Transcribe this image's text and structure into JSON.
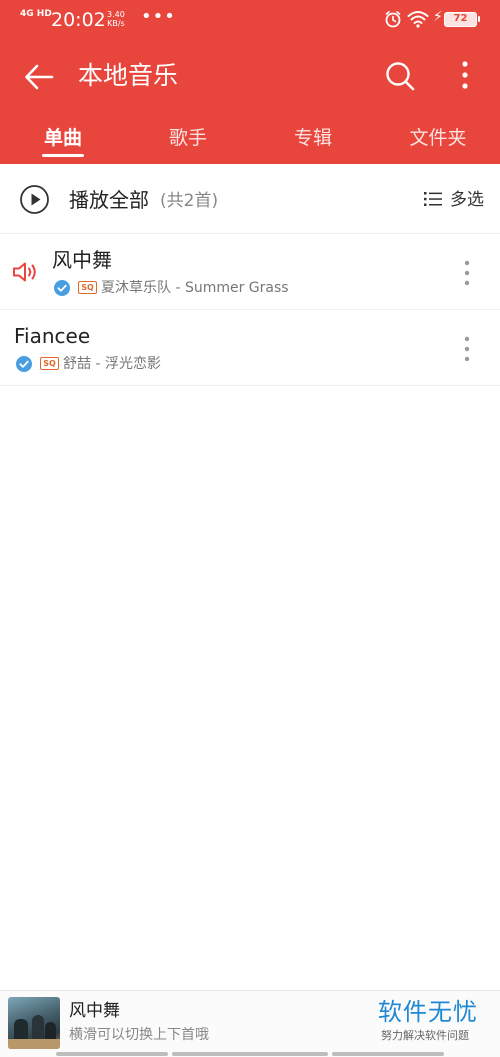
{
  "status_bar": {
    "network": "4G HD",
    "time": "20:02",
    "speed_value": "3.40",
    "speed_unit": "KB/s",
    "more": "•••",
    "battery": "72"
  },
  "header": {
    "title": "本地音乐",
    "tabs": [
      {
        "label": "单曲",
        "active": true
      },
      {
        "label": "歌手",
        "active": false
      },
      {
        "label": "专辑",
        "active": false
      },
      {
        "label": "文件夹",
        "active": false
      }
    ]
  },
  "play_all": {
    "label": "播放全部",
    "count": "(共2首)",
    "multi_select": "多选"
  },
  "songs": [
    {
      "title": "风中舞",
      "badge": "SQ",
      "artist_album": "夏沐草乐队 - Summer Grass",
      "playing": true
    },
    {
      "title": "Fiancee",
      "badge": "SQ",
      "artist_album": "舒喆 - 浮光恋影",
      "playing": false
    }
  ],
  "mini_player": {
    "title": "风中舞",
    "hint": "横滑可以切换上下首哦"
  },
  "watermark": {
    "main": "软件无忧",
    "sub": "努力解决软件问题"
  },
  "colors": {
    "accent": "#e8453c",
    "verified": "#4a9ee0",
    "sq_badge": "#e06a2c",
    "watermark": "#1e88d4"
  }
}
